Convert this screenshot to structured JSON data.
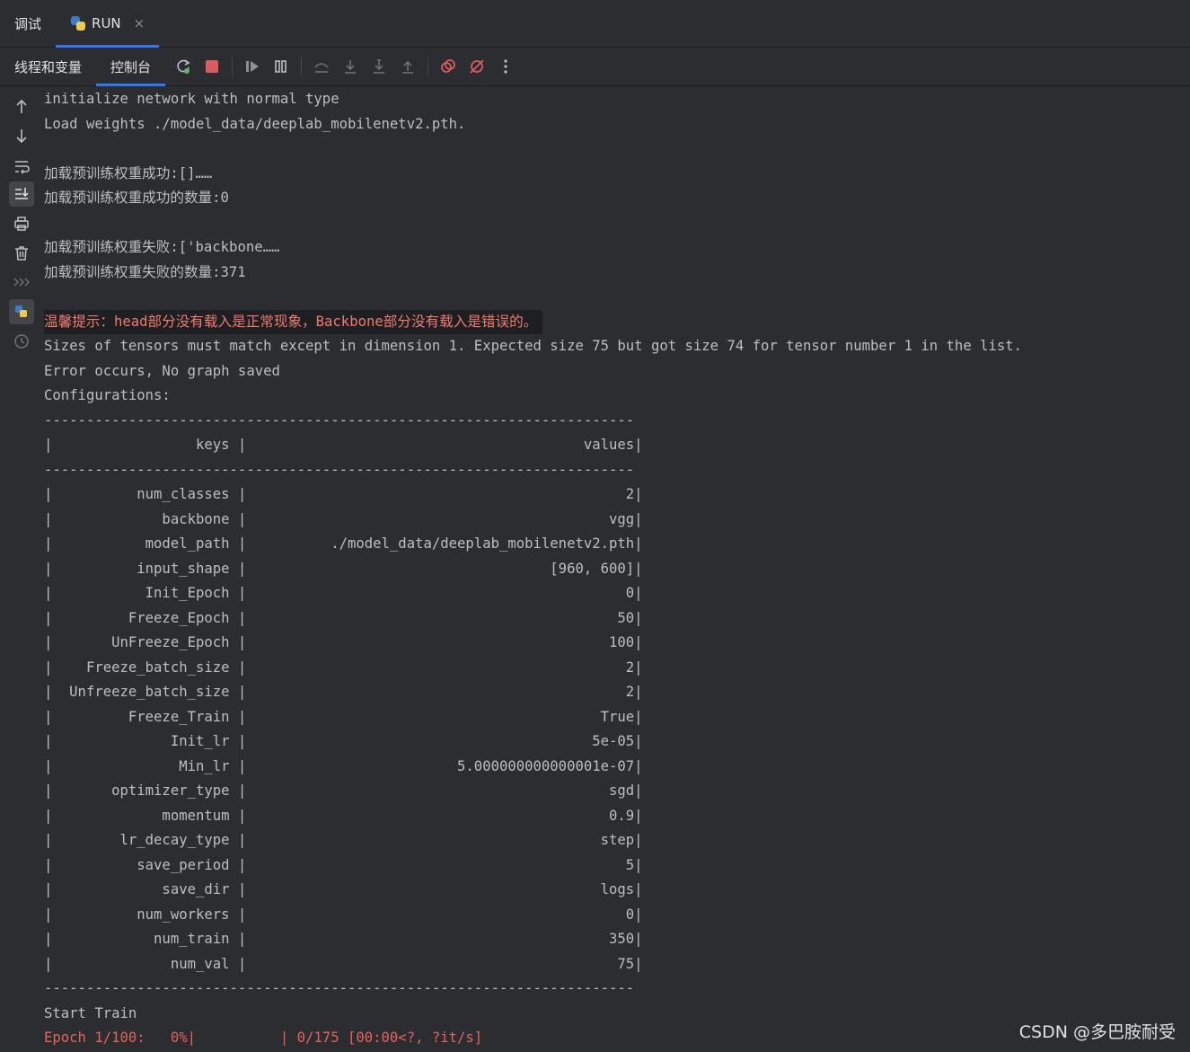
{
  "tabs": [
    {
      "label": "调试"
    },
    {
      "label": "RUN",
      "close": "×"
    }
  ],
  "subtabs": [
    {
      "label": "线程和变量"
    },
    {
      "label": "控制台"
    }
  ],
  "console_lines": [
    {
      "text": "initialize network with normal type"
    },
    {
      "text": "Load weights ./model_data/deeplab_mobilenetv2.pth."
    },
    {
      "text": ""
    },
    {
      "text": "加载预训练权重成功:[]……"
    },
    {
      "text": "加载预训练权重成功的数量:0"
    },
    {
      "text": ""
    },
    {
      "text": "加载预训练权重失败:['backbone……"
    },
    {
      "text": "加载预训练权重失败的数量:371"
    },
    {
      "text": ""
    },
    {
      "text": "温馨提示：head部分没有载入是正常现象，Backbone部分没有载入是错误的。",
      "style": "warn"
    },
    {
      "text": "Sizes of tensors must match except in dimension 1. Expected size 75 but got size 74 for tensor number 1 in the list."
    },
    {
      "text": "Error occurs, No graph saved"
    },
    {
      "text": "Configurations:"
    },
    {
      "text": "----------------------------------------------------------------------"
    },
    {
      "text": "|                 keys |                                        values|"
    },
    {
      "text": "----------------------------------------------------------------------"
    },
    {
      "text": "|          num_classes |                                             2|"
    },
    {
      "text": "|             backbone |                                           vgg|"
    },
    {
      "text": "|           model_path |          ./model_data/deeplab_mobilenetv2.pth|"
    },
    {
      "text": "|          input_shape |                                    [960, 600]|"
    },
    {
      "text": "|           Init_Epoch |                                             0|"
    },
    {
      "text": "|         Freeze_Epoch |                                            50|"
    },
    {
      "text": "|       UnFreeze_Epoch |                                           100|"
    },
    {
      "text": "|    Freeze_batch_size |                                             2|"
    },
    {
      "text": "|  Unfreeze_batch_size |                                             2|"
    },
    {
      "text": "|         Freeze_Train |                                          True|"
    },
    {
      "text": "|              Init_lr |                                         5e-05|"
    },
    {
      "text": "|               Min_lr |                         5.000000000000001e-07|"
    },
    {
      "text": "|       optimizer_type |                                           sgd|"
    },
    {
      "text": "|             momentum |                                           0.9|"
    },
    {
      "text": "|        lr_decay_type |                                          step|"
    },
    {
      "text": "|          save_period |                                             5|"
    },
    {
      "text": "|             save_dir |                                          logs|"
    },
    {
      "text": "|          num_workers |                                             0|"
    },
    {
      "text": "|            num_train |                                           350|"
    },
    {
      "text": "|              num_val |                                            75|"
    },
    {
      "text": "----------------------------------------------------------------------"
    },
    {
      "text": "Start Train"
    },
    {
      "text": "Epoch 1/100:   0%|          | 0/175 [00:00<?, ?it/s]",
      "style": "red"
    }
  ],
  "watermark": "CSDN @多巴胺耐受",
  "colors": {
    "accent": "#3574f0",
    "error_text": "#e3645b",
    "background": "#2b2d30"
  }
}
